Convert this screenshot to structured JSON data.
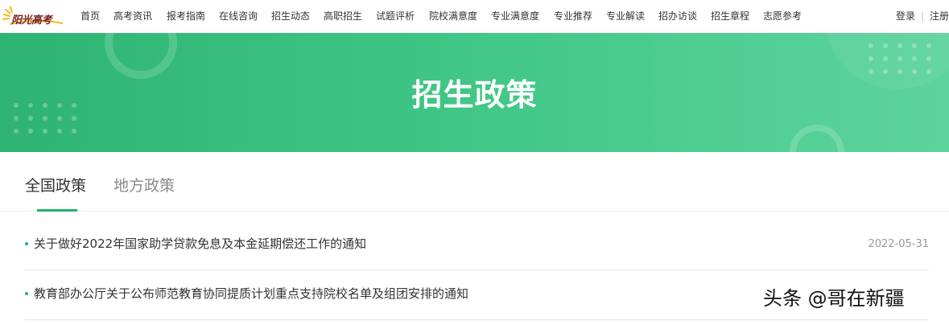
{
  "header": {
    "logo_text": "阳光高考",
    "nav": [
      {
        "label": "首页"
      },
      {
        "label": "高考资讯"
      },
      {
        "label": "报考指南"
      },
      {
        "label": "在线咨询"
      },
      {
        "label": "招生动态"
      },
      {
        "label": "高职招生"
      },
      {
        "label": "试题评析"
      },
      {
        "label": "院校满意度"
      },
      {
        "label": "专业满意度"
      },
      {
        "label": "专业推荐"
      },
      {
        "label": "专业解读"
      },
      {
        "label": "招办访谈"
      },
      {
        "label": "招生章程"
      },
      {
        "label": "志愿参考"
      }
    ],
    "login_label": "登录",
    "register_label": "注册",
    "separator": "|"
  },
  "banner": {
    "title": "招生政策",
    "colors": {
      "start": "#2fb372",
      "end": "#5dd39d"
    }
  },
  "tabs": [
    {
      "label": "全国政策",
      "active": true
    },
    {
      "label": "地方政策",
      "active": false
    }
  ],
  "news": [
    {
      "title": "关于做好2022年国家助学贷款免息及本金延期偿还工作的通知",
      "date": "2022-05-31"
    },
    {
      "title": "教育部办公厅关于公布师范教育协同提质计划重点支持院校名单及组团安排的通知",
      "date": ""
    }
  ],
  "watermark": "头条 @哥在新疆",
  "accent_color": "#22b36f"
}
